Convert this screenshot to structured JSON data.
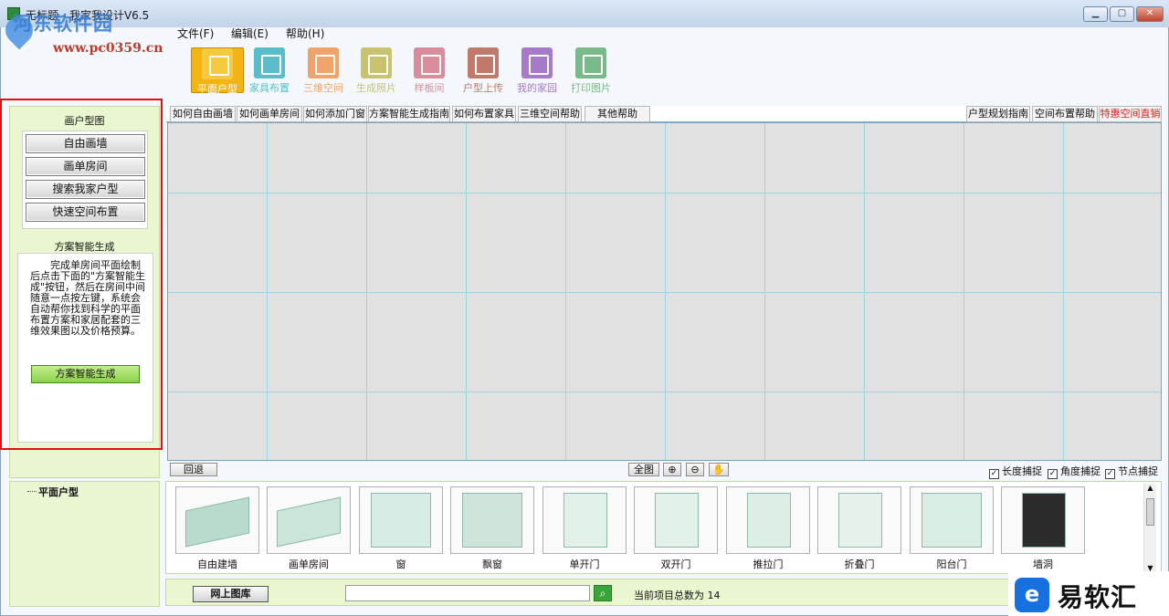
{
  "window": {
    "title": "无标题 - 我家我设计V6.5"
  },
  "watermark": {
    "site": "河东软件园",
    "url": "www.pc0359.cn"
  },
  "menu": [
    "文件(F)",
    "编辑(E)",
    "帮助(H)"
  ],
  "toolbar": [
    {
      "label": "平面户型",
      "icon": "pencil-icon",
      "color": "#f3b514",
      "active": true
    },
    {
      "label": "家具布置",
      "icon": "chair-icon",
      "color": "#5bbcc9"
    },
    {
      "label": "三维空间",
      "icon": "cube-icon",
      "color": "#f0a46a"
    },
    {
      "label": "生成照片",
      "icon": "camera-icon",
      "color": "#c9c26f"
    },
    {
      "label": "样板间",
      "icon": "room-icon",
      "color": "#d98c9c"
    },
    {
      "label": "户型上传",
      "icon": "disk-icon",
      "color": "#c07a6c"
    },
    {
      "label": "我的家园",
      "icon": "home-icon",
      "color": "#a57ac9"
    },
    {
      "label": "打印图片",
      "icon": "printer-icon",
      "color": "#7ab98a"
    }
  ],
  "left": {
    "draw_title": "画户型图",
    "buttons": [
      "自由画墙",
      "画单房间",
      "搜索我家户型",
      "快速空间布置"
    ],
    "smart_title": "方案智能生成",
    "smart_desc": "完成单房间平面绘制后点击下面的\"方案智能生成\"按钮，然后在房间中间随意一点按左键，系统会自动帮你找到科学的平面布置方案和家居配套的三维效果图以及价格预算。",
    "smart_button": "方案智能生成"
  },
  "help_tabs": [
    "如何自由画墙",
    "如何画单房间",
    "如何添加门窗",
    "方案智能生成指南",
    "如何布置家具",
    "三维空间帮助",
    "其他帮助"
  ],
  "help_tabs_right": [
    "户型规划指南",
    "空间布置帮助",
    "特惠空间直销"
  ],
  "canvas_bar": {
    "back": "回退",
    "full": "全图",
    "checks": [
      {
        "label": "长度捕捉",
        "checked": true
      },
      {
        "label": "角度捕捉",
        "checked": true
      },
      {
        "label": "节点捕捉",
        "checked": true
      }
    ]
  },
  "tree": {
    "root": "平面户型"
  },
  "gallery": [
    "自由建墙",
    "画单房间",
    "窗",
    "飘窗",
    "单开门",
    "双开门",
    "推拉门",
    "折叠门",
    "阳台门",
    "墙洞"
  ],
  "bottom": {
    "net_button": "网上图库",
    "search_value": "",
    "count_text": "当前项目总数为 14"
  },
  "brand": {
    "name": "易软汇"
  }
}
